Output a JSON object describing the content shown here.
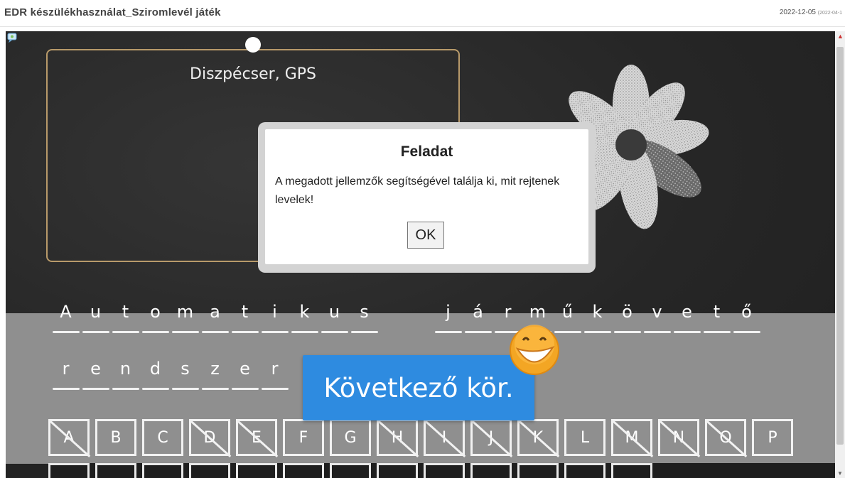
{
  "page": {
    "title": "EDR készülékhasználat_Sziromlevél játék",
    "date": "2022-12-05",
    "date_sub": "(2022-04-1"
  },
  "game": {
    "clue_text": "Diszpécser, GPS",
    "word_rows": [
      [
        "A",
        "u",
        "t",
        "o",
        "m",
        "a",
        "t",
        "i",
        "k",
        "u",
        "s"
      ],
      [
        "j",
        "á",
        "r",
        "m",
        "ű",
        "k",
        "ö",
        "v",
        "e",
        "t",
        "ő"
      ],
      [
        "r",
        "e",
        "n",
        "d",
        "s",
        "z",
        "e",
        "r"
      ]
    ],
    "keys": [
      {
        "label": "A",
        "used": true
      },
      {
        "label": "B",
        "used": false
      },
      {
        "label": "C",
        "used": false
      },
      {
        "label": "D",
        "used": true
      },
      {
        "label": "E",
        "used": true
      },
      {
        "label": "F",
        "used": false
      },
      {
        "label": "G",
        "used": false
      },
      {
        "label": "H",
        "used": true
      },
      {
        "label": "I",
        "used": true
      },
      {
        "label": "J",
        "used": true
      },
      {
        "label": "K",
        "used": true
      },
      {
        "label": "L",
        "used": false
      },
      {
        "label": "M",
        "used": true
      },
      {
        "label": "N",
        "used": true
      },
      {
        "label": "O",
        "used": true
      },
      {
        "label": "P",
        "used": false
      }
    ],
    "next_button_label": "Következő kör."
  },
  "dialog": {
    "title": "Feladat",
    "body": "A megadott jellemzők segítségével találja ki, mit rejtenek levelek!",
    "ok_label": "OK"
  },
  "colors": {
    "board": "#2a2a2a",
    "band": "#8f8f8f",
    "next_button": "#2e8be0",
    "clue_border": "#b89a6a"
  }
}
